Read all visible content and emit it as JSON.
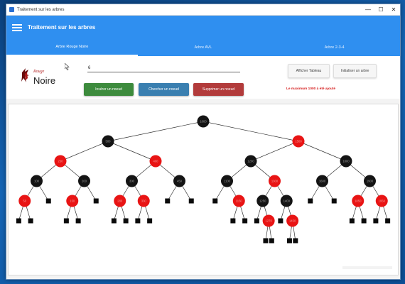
{
  "window": {
    "title": "Traitement sur les arbres",
    "controls": {
      "minimize": "—",
      "maximize": "☐",
      "close": "✕"
    }
  },
  "appbar": {
    "title": "Traitement sur les arbres"
  },
  "tabs": [
    {
      "label": "Arbre Rouge Noire",
      "active": true
    },
    {
      "label": "Arbre AVL",
      "active": false
    },
    {
      "label": "Arbre 2-3-4",
      "active": false
    }
  ],
  "logo": {
    "small_text": "Rouge",
    "big_text": "Noire"
  },
  "input": {
    "value": "6"
  },
  "buttons": {
    "insert": "Insérer un noeud",
    "find": "Chercher un noeud",
    "delete": "Supprimer un noeud",
    "show_table": "Afficher Tableau",
    "reset_tree": "Initialiser un arbre"
  },
  "error_message": "Le maximum 1000 à été ajouté",
  "colors": {
    "red_node": "#e81414",
    "black_node": "#141414",
    "accent": "#2f8ff0"
  },
  "tree": {
    "id": "r",
    "color": "black",
    "label": "1000",
    "children": [
      {
        "id": "a",
        "color": "black",
        "label": "500",
        "children": [
          {
            "id": "aa",
            "color": "red",
            "label": "250",
            "children": [
              {
                "id": "aaa",
                "color": "black",
                "label": "100",
                "children": [
                  {
                    "id": "aaaa",
                    "color": "red",
                    "label": "50",
                    "children": [
                      {
                        "nil": true
                      },
                      {
                        "nil": true
                      }
                    ]
                  },
                  {
                    "nil": true
                  }
                ]
              },
              {
                "id": "aab",
                "color": "black",
                "label": "200",
                "children": [
                  {
                    "id": "aaba",
                    "color": "red",
                    "label": "150",
                    "children": [
                      {
                        "nil": true
                      },
                      {
                        "nil": true
                      }
                    ]
                  },
                  {
                    "nil": true
                  }
                ]
              }
            ]
          },
          {
            "id": "ab",
            "color": "red",
            "label": "400",
            "children": [
              {
                "id": "aba",
                "color": "black",
                "label": "300",
                "children": [
                  {
                    "id": "abaa",
                    "color": "red",
                    "label": "280",
                    "children": [
                      {
                        "nil": true
                      },
                      {
                        "nil": true
                      }
                    ]
                  },
                  {
                    "id": "abab",
                    "color": "red",
                    "label": "330",
                    "children": [
                      {
                        "nil": true
                      },
                      {
                        "nil": true
                      }
                    ]
                  }
                ]
              },
              {
                "id": "abb",
                "color": "black",
                "label": "450",
                "children": [
                  {
                    "nil": true
                  },
                  {
                    "nil": true
                  }
                ]
              }
            ]
          }
        ]
      },
      {
        "id": "b",
        "color": "red",
        "label": "1500",
        "children": [
          {
            "id": "ba",
            "color": "black",
            "label": "1200",
            "children": [
              {
                "id": "baa",
                "color": "black",
                "label": "1100",
                "children": [
                  {
                    "nil": true
                  },
                  {
                    "id": "baab",
                    "color": "red",
                    "label": "1150",
                    "children": [
                      {
                        "nil": true
                      },
                      {
                        "nil": true
                      }
                    ]
                  }
                ]
              },
              {
                "id": "bab",
                "color": "red",
                "label": "1300",
                "children": [
                  {
                    "id": "baba",
                    "color": "black",
                    "label": "1250",
                    "children": [
                      {
                        "nil": true
                      },
                      {
                        "id": "babab",
                        "color": "red",
                        "label": "1270",
                        "children": [
                          {
                            "nil": true
                          },
                          {
                            "nil": true
                          }
                        ]
                      }
                    ]
                  },
                  {
                    "id": "babb",
                    "color": "black",
                    "label": "1400",
                    "children": [
                      {
                        "nil": true
                      },
                      {
                        "id": "babbb",
                        "color": "red",
                        "label": "1450",
                        "children": [
                          {
                            "nil": true
                          },
                          {
                            "nil": true
                          }
                        ]
                      }
                    ]
                  }
                ]
              }
            ]
          },
          {
            "id": "bb",
            "color": "black",
            "label": "1800",
            "children": [
              {
                "id": "bba",
                "color": "black",
                "label": "1600",
                "children": [
                  {
                    "nil": true
                  },
                  {
                    "nil": true
                  }
                ]
              },
              {
                "id": "bbb",
                "color": "black",
                "label": "1900",
                "children": [
                  {
                    "id": "bbba",
                    "color": "red",
                    "label": "1850",
                    "children": [
                      {
                        "nil": true
                      },
                      {
                        "nil": true
                      }
                    ]
                  },
                  {
                    "id": "bbbb",
                    "color": "red",
                    "label": "1950",
                    "children": [
                      {
                        "nil": true
                      },
                      {
                        "nil": true
                      }
                    ]
                  }
                ]
              }
            ]
          }
        ]
      }
    ]
  }
}
